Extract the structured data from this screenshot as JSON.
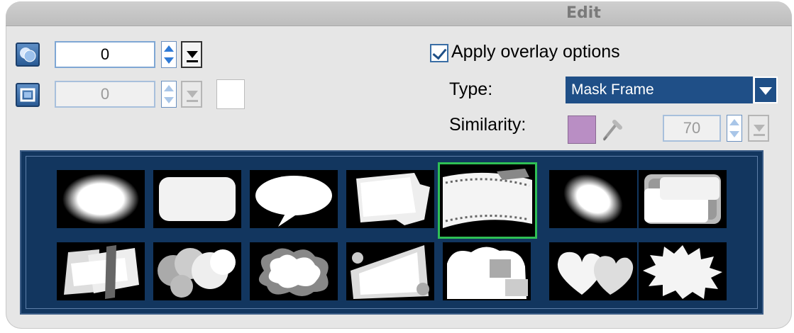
{
  "panel": {
    "title": "Edit"
  },
  "overlay_controls": {
    "primary_value": "0",
    "secondary_value": "0"
  },
  "apply_overlay": {
    "label": "Apply overlay options",
    "checked": true
  },
  "type": {
    "label": "Type:",
    "value": "Mask Frame"
  },
  "similarity": {
    "label": "Similarity:",
    "color": "#b98ec4",
    "value": "70"
  },
  "gallery": {
    "selected_index": 4,
    "thumbnails": [
      {
        "shape": "ellipse"
      },
      {
        "shape": "rounded-rectangle"
      },
      {
        "shape": "speech-bubble"
      },
      {
        "shape": "torn-paper"
      },
      {
        "shape": "film-strip"
      },
      {
        "shape": "tilted-ellipse"
      },
      {
        "shape": "stepped-rectangles"
      },
      {
        "shape": "brush-strokes"
      },
      {
        "shape": "bubbles"
      },
      {
        "shape": "cloud-splotch"
      },
      {
        "shape": "floral-burst"
      },
      {
        "shape": "cloud-collage"
      },
      {
        "shape": "hearts"
      },
      {
        "shape": "flower-burst"
      }
    ]
  },
  "colors": {
    "accent": "#1f4f87",
    "gallery_bg": "#12365f",
    "selection": "#2fbf55"
  }
}
